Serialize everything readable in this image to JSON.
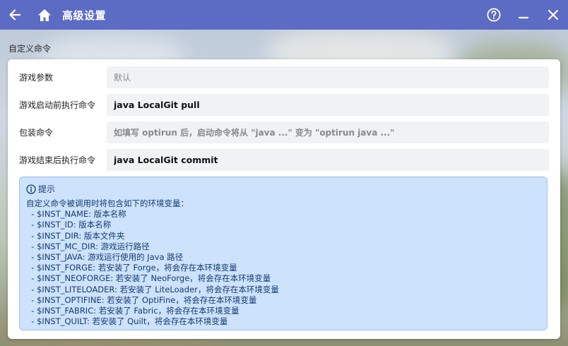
{
  "window": {
    "title": "高级设置",
    "icons": {
      "back": "arrow-left-icon",
      "home": "home-icon",
      "help": "help-circle-icon",
      "minimize": "minimize-icon",
      "close": "close-icon"
    },
    "accent_color": "#5c6bc4"
  },
  "section": {
    "label": "自定义命令"
  },
  "fields": [
    {
      "label": "游戏参数",
      "value": "",
      "placeholder": "默认"
    },
    {
      "label": "游戏启动前执行命令",
      "value": "java LocalGit pull",
      "placeholder": ""
    },
    {
      "label": "包装命令",
      "value": "",
      "placeholder": "如填写 optirun 后，启动命令将从 \"java ...\" 变为 \"optirun java ...\""
    },
    {
      "label": "游戏结束后执行命令",
      "value": "java LocalGit commit",
      "placeholder": ""
    }
  ],
  "hint": {
    "icon": "info-circle-icon",
    "title": "提示",
    "lines": [
      "自定义命令被调用时将包含如下的环境变量：",
      "  - $INST_NAME: 版本名称",
      "  - $INST_ID: 版本名称",
      "  - $INST_DIR: 版本文件夹",
      "  - $INST_MC_DIR: 游戏运行路径",
      "  - $INST_JAVA: 游戏运行使用的 Java 路径",
      "  - $INST_FORGE: 若安装了 Forge，将会存在本环境变量",
      "  - $INST_NEOFORGE: 若安装了 NeoForge，将会存在本环境变量",
      "  - $INST_LITELOADER: 若安装了 LiteLoader，将会存在本环境变量",
      "  - $INST_OPTIFINE: 若安装了 OptiFine，将会存在本环境变量",
      "  - $INST_FABRIC: 若安装了 Fabric，将会存在本环境变量",
      "  - $INST_QUILT: 若安装了 Quilt，将会存在本环境变量"
    ],
    "background_color": "#cde2fb",
    "text_color": "#123a75"
  }
}
